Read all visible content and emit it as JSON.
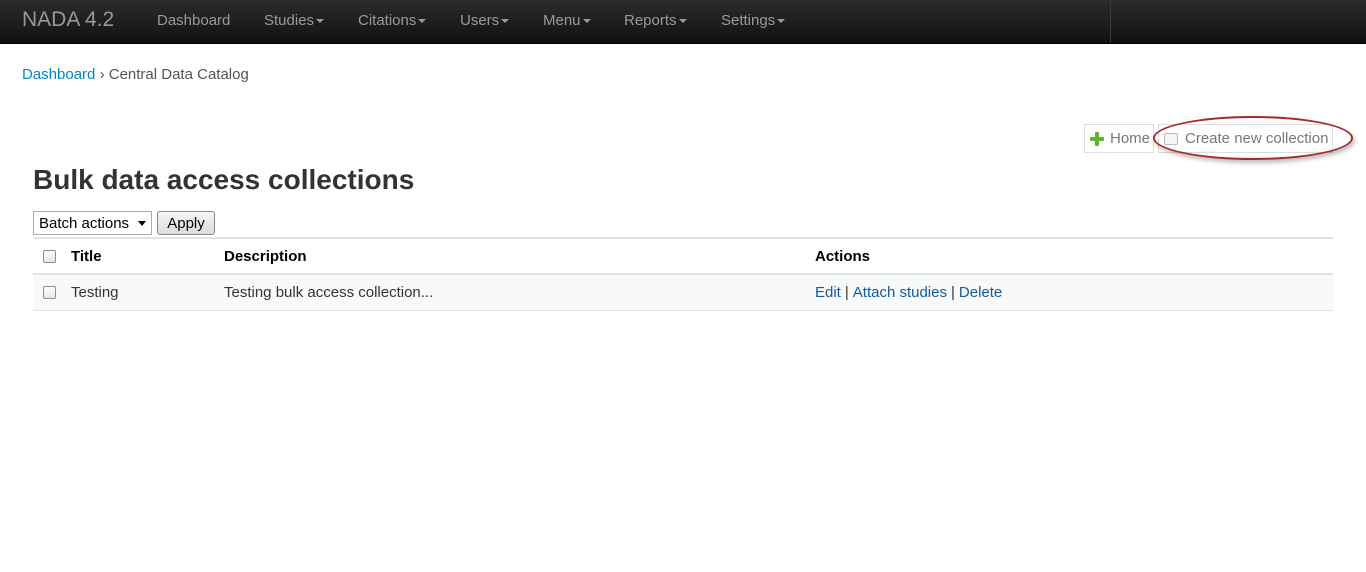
{
  "navbar": {
    "brand": "NADA 4.2",
    "items": [
      {
        "label": "Dashboard",
        "dropdown": false
      },
      {
        "label": "Studies",
        "dropdown": true
      },
      {
        "label": "Citations",
        "dropdown": true
      },
      {
        "label": "Users",
        "dropdown": true
      },
      {
        "label": "Menu",
        "dropdown": true
      },
      {
        "label": "Reports",
        "dropdown": true
      },
      {
        "label": "Settings",
        "dropdown": true
      }
    ]
  },
  "breadcrumb": {
    "link": "Dashboard",
    "separator": "›",
    "current": "Central Data Catalog"
  },
  "toolbar": {
    "home_label": "Home",
    "home_icon": "plus-icon",
    "create_label": "Create new collection",
    "create_icon": "folder-icon"
  },
  "page": {
    "title": "Bulk data access collections"
  },
  "batch": {
    "selected": "Batch actions",
    "apply_label": "Apply"
  },
  "table": {
    "headers": {
      "title": "Title",
      "description": "Description",
      "actions": "Actions"
    },
    "rows": [
      {
        "title": "Testing",
        "description": "Testing bulk access collection...",
        "actions": [
          "Edit",
          "Attach studies",
          "Delete"
        ],
        "separator": "|"
      }
    ]
  },
  "colors": {
    "navbar_bg": "#1b1b1b",
    "link": "#0088cc",
    "highlight": "#a52a2a",
    "plus_icon": "#5cb530"
  }
}
